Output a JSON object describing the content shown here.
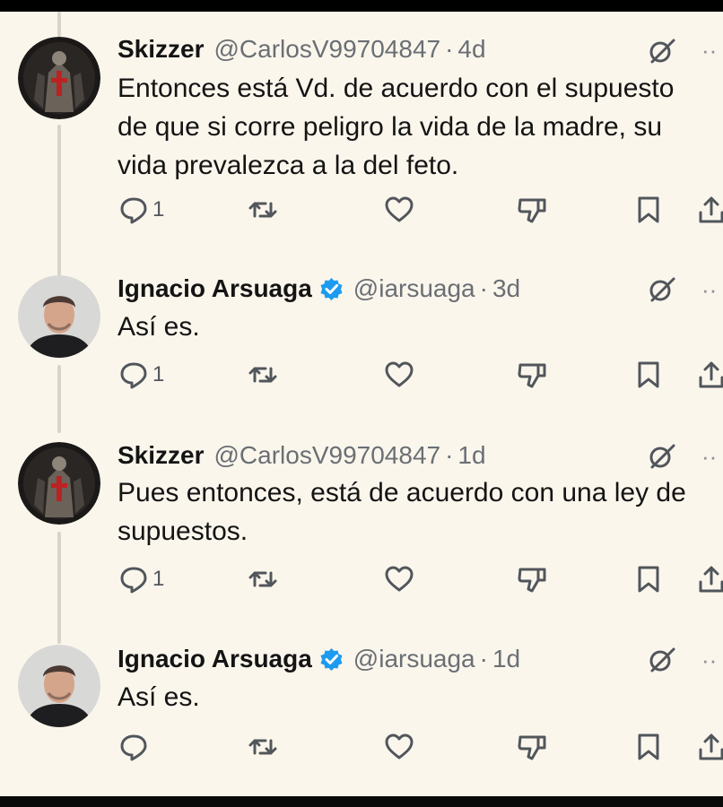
{
  "tweets": [
    {
      "name": "Skizzer",
      "verified": false,
      "handle": "@CarlosV99704847",
      "separator": "·",
      "time": "4d",
      "lines": [
        "Entonces está Vd. de acuerdo con el supuesto",
        "de que si corre peligro la vida de la madre, su",
        "vida prevalezca a la del feto."
      ],
      "reply_count": "1"
    },
    {
      "name": "Ignacio Arsuaga",
      "verified": true,
      "handle": "@iarsuaga",
      "separator": "·",
      "time": "3d",
      "lines": [
        "Así es."
      ],
      "reply_count": "1"
    },
    {
      "name": "Skizzer",
      "verified": false,
      "handle": "@CarlosV99704847",
      "separator": "·",
      "time": "1d",
      "lines": [
        "Pues entonces, está de acuerdo con una ley de",
        "supuestos."
      ],
      "reply_count": "1"
    },
    {
      "name": "Ignacio Arsuaga",
      "verified": true,
      "handle": "@iarsuaga",
      "separator": "·",
      "time": "1d",
      "lines": [
        "Así es."
      ],
      "reply_count": ""
    }
  ],
  "icons": {
    "reply": "reply-icon",
    "retweet": "retweet-icon",
    "like": "heart-icon",
    "dislike": "thumbs-down-icon",
    "bookmark": "bookmark-icon",
    "share": "share-icon",
    "grok": "grok-icon",
    "more": "more-icon"
  },
  "colors": {
    "background": "#fbf6ec",
    "text": "#141414",
    "secondary": "#6a6f74",
    "verified": "#1d9bf0",
    "icon": "#51565b"
  }
}
